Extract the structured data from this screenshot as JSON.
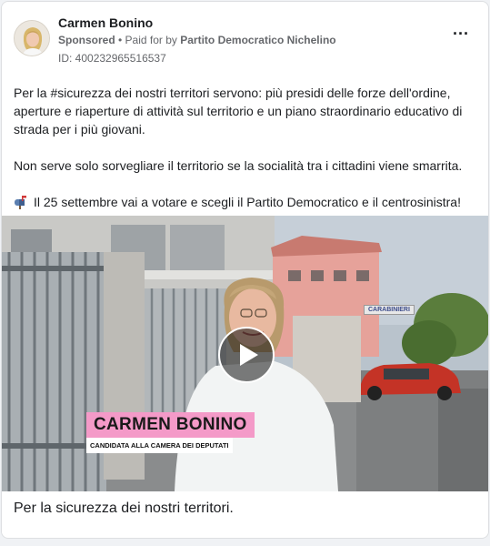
{
  "post": {
    "page_name": "Carmen Bonino",
    "sponsored_label": "Sponsored",
    "paid_for_prefix": " • Paid for by ",
    "payer": "Partito Democratico Nichelino",
    "ad_id": "ID: 400232965516537",
    "more_icon": "ellipsis-icon",
    "body_paragraph_1": "Per la #sicurezza dei nostri territori servono: più presidi delle forze dell'ordine, aperture e riaperture di attività sul territorio e un piano straordinario educativo di strada per i più giovani.",
    "body_paragraph_2": "Non serve solo sorvegliare il territorio se la socialità tra i cittadini viene smarrita.",
    "body_paragraph_3": "Il 25 settembre vai a votare e scegli il Partito Democratico e il centrosinistra!",
    "paragraph_3_icon": "mailbox-icon"
  },
  "video": {
    "overlay_name": "CARMEN BONINO",
    "overlay_role": "CANDIDATA ALLA CAMERA DEI DEPUTATI",
    "sign_text": "CARABINIERI",
    "play_icon": "play-icon",
    "accent_pink": "#f49ac8"
  },
  "caption": "Per la sicurezza dei nostri territori."
}
